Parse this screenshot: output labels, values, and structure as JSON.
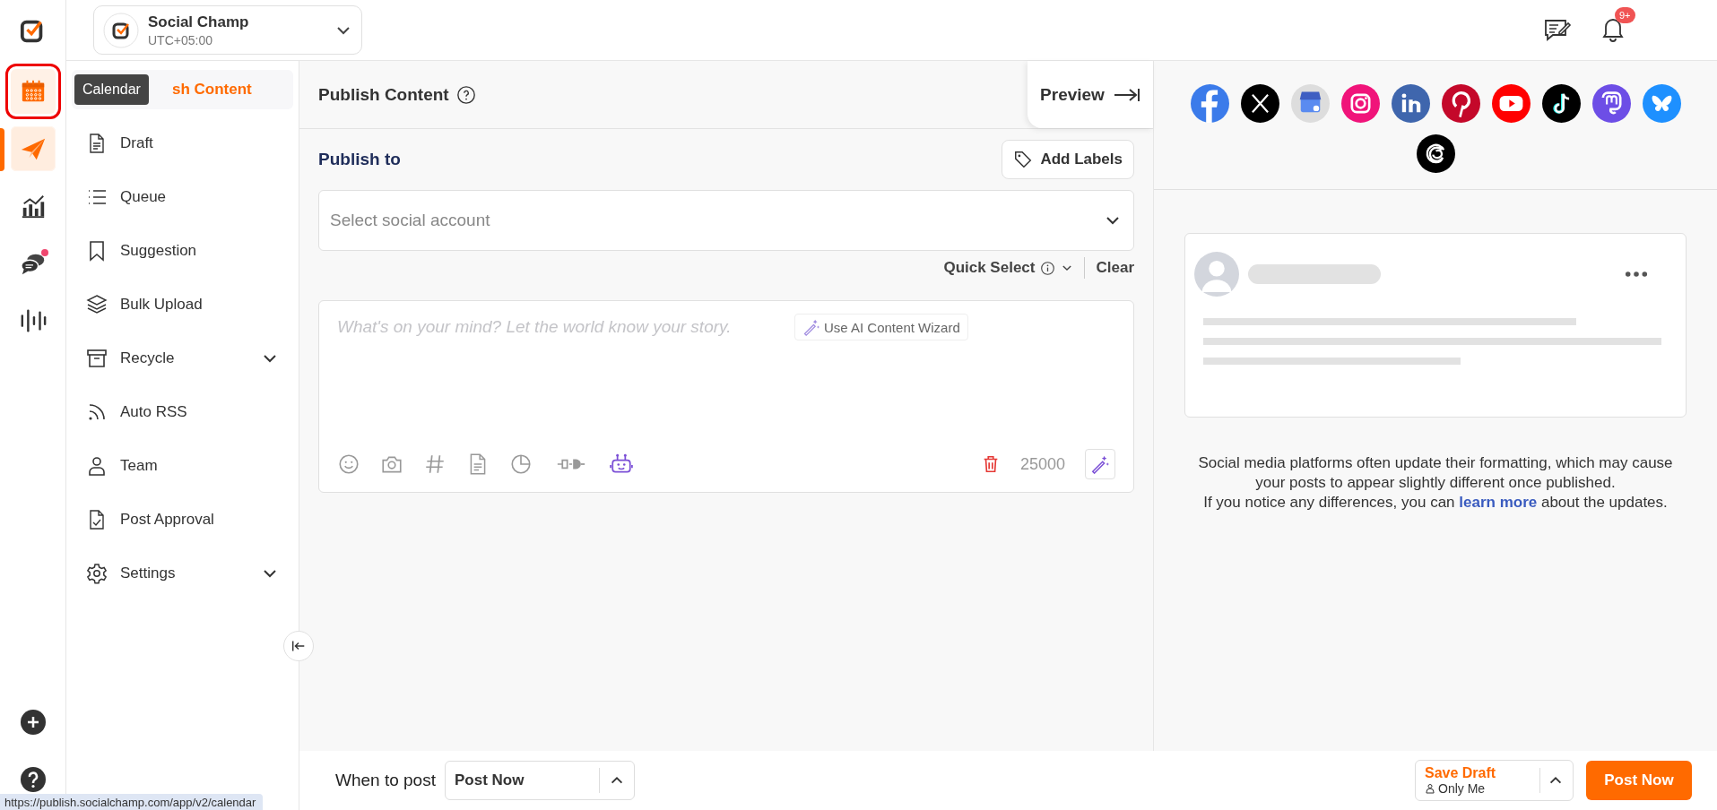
{
  "rail": {
    "items": [
      {
        "kind": "calendar",
        "selected": false,
        "hovered": true,
        "outlined": true,
        "dot": false
      },
      {
        "kind": "send",
        "selected": true,
        "hovered": false,
        "outlined": false,
        "dot": false
      },
      {
        "kind": "chart",
        "selected": false,
        "hovered": false,
        "outlined": false,
        "dot": false
      },
      {
        "kind": "chat",
        "selected": false,
        "hovered": false,
        "outlined": false,
        "dot": true
      },
      {
        "kind": "wave",
        "selected": false,
        "hovered": false,
        "outlined": false,
        "dot": false
      }
    ],
    "tooltip": "Calendar"
  },
  "account": {
    "name": "Social Champ",
    "timezone": "UTC+05:00"
  },
  "notifications": {
    "badge": "9+"
  },
  "nav": [
    {
      "label": "sh Content",
      "kind": "content",
      "selected": true,
      "expandable": false
    },
    {
      "label": "Draft",
      "kind": "doc",
      "selected": false,
      "expandable": false
    },
    {
      "label": "Queue",
      "kind": "list",
      "selected": false,
      "expandable": false
    },
    {
      "label": "Suggestion",
      "kind": "bookmark",
      "selected": false,
      "expandable": false
    },
    {
      "label": "Bulk Upload",
      "kind": "layers",
      "selected": false,
      "expandable": false
    },
    {
      "label": "Recycle",
      "kind": "archive",
      "selected": false,
      "expandable": true
    },
    {
      "label": "Auto RSS",
      "kind": "rss",
      "selected": false,
      "expandable": false
    },
    {
      "label": "Team",
      "kind": "person",
      "selected": false,
      "expandable": false
    },
    {
      "label": "Post Approval",
      "kind": "doccheck",
      "selected": false,
      "expandable": false
    },
    {
      "label": "Settings",
      "kind": "gear",
      "selected": false,
      "expandable": true
    }
  ],
  "composer": {
    "title": "Publish Content",
    "preview_tab": "Preview",
    "publish_to": "Publish to",
    "add_labels": "Add Labels",
    "account_select": {
      "placeholder": "Select social account"
    },
    "quick_select": "Quick Select",
    "clear": "Clear",
    "editor": {
      "placeholder": "What's on your mind? Let the world know your story."
    },
    "ai_button": "Use AI Content Wizard",
    "tools": [
      {
        "kind": "emoji"
      },
      {
        "kind": "camera"
      },
      {
        "kind": "hash"
      },
      {
        "kind": "doc"
      },
      {
        "kind": "pie"
      },
      {
        "kind": "plug"
      },
      {
        "kind": "robot"
      }
    ],
    "char_count": "25000"
  },
  "preview": {
    "networks": [
      {
        "kind": "facebook"
      },
      {
        "kind": "x"
      },
      {
        "kind": "gmb"
      },
      {
        "kind": "instagram"
      },
      {
        "kind": "linkedin"
      },
      {
        "kind": "pinterest"
      },
      {
        "kind": "youtube"
      },
      {
        "kind": "tiktok"
      },
      {
        "kind": "mastodon"
      },
      {
        "kind": "bluesky"
      },
      {
        "kind": "threads"
      }
    ],
    "notice": {
      "line1": "Social media platforms often update their formatting, which may cause your posts to appear slightly different once published.",
      "line2_before": "If you notice any differences, you can ",
      "link": "learn more",
      "line2_after": " about the updates."
    }
  },
  "footer": {
    "when_label": "When to post",
    "when_value": "Post Now",
    "save_draft": "Save Draft",
    "visibility": "Only Me",
    "post_button": "Post Now"
  },
  "status_url": "https://publish.socialchamp.com/app/v2/calendar"
}
